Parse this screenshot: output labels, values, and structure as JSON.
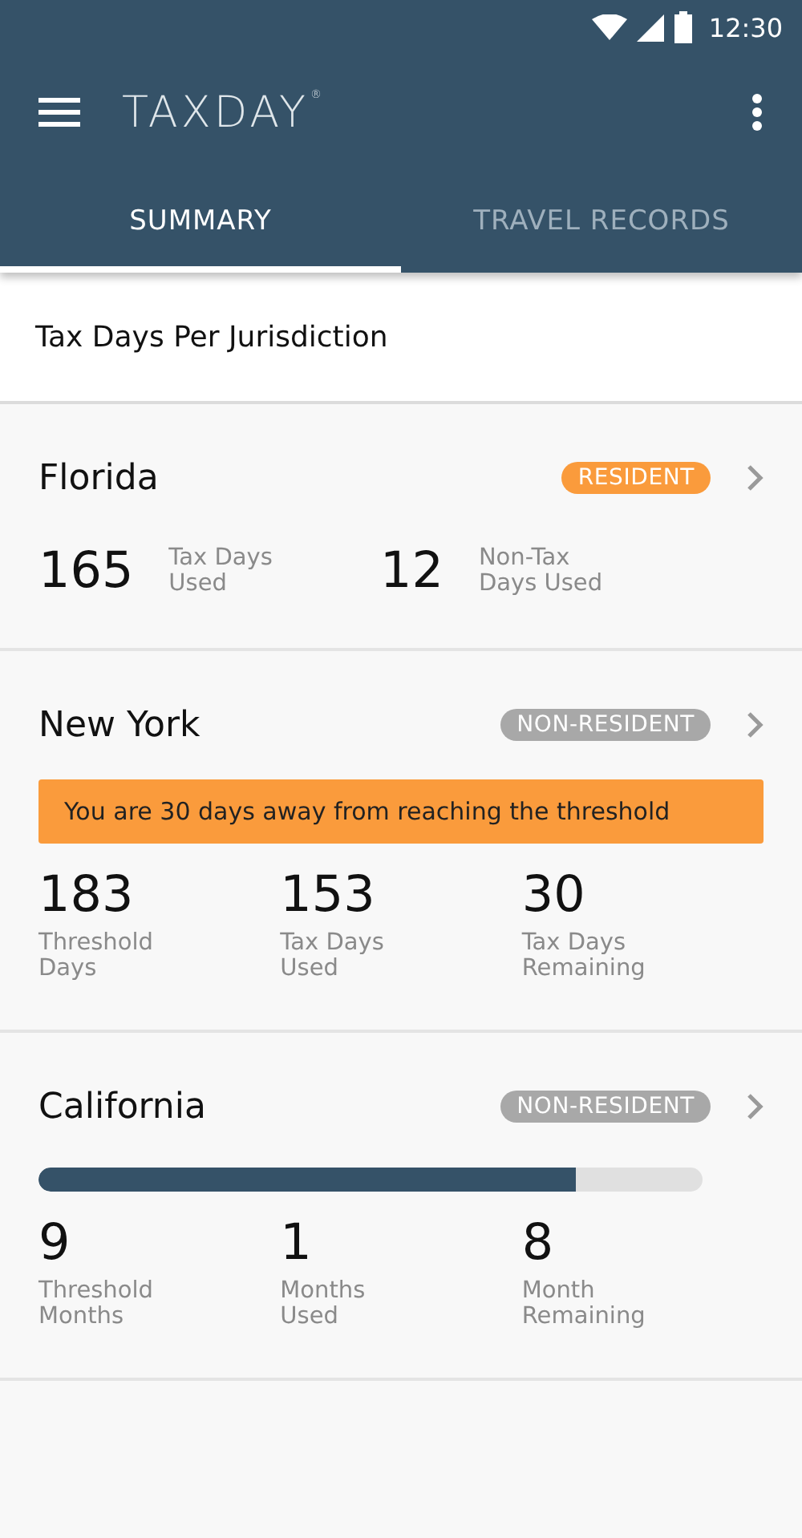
{
  "status_bar": {
    "time": "12:30"
  },
  "app_bar": {
    "title": "TAXDAY",
    "mark": "®"
  },
  "tabs": [
    {
      "label": "SUMMARY",
      "selected": true
    },
    {
      "label": "TRAVEL RECORDS",
      "selected": false
    }
  ],
  "section_title": "Tax Days Per Jurisdiction",
  "jurisdictions": [
    {
      "name": "Florida",
      "badge": {
        "text": "RESIDENT",
        "color": "#fa9b3c"
      },
      "kind": "inline",
      "stats": [
        {
          "value": "165",
          "label": "Tax Days\nUsed"
        },
        {
          "value": "12",
          "label": "Non-Tax\nDays Used"
        }
      ]
    },
    {
      "name": "New York",
      "badge": {
        "text": "NON-RESIDENT",
        "color": "#a8a8a8"
      },
      "kind": "stacked",
      "alert": "You are 30 days away from reaching the threshold",
      "stats": [
        {
          "value": "183",
          "label": "Threshold\nDays"
        },
        {
          "value": "153",
          "label": "Tax Days\nUsed"
        },
        {
          "value": "30",
          "label": "Tax Days\nRemaining"
        }
      ]
    },
    {
      "name": "California",
      "badge": {
        "text": "NON-RESIDENT",
        "color": "#a8a8a8"
      },
      "kind": "stacked",
      "progress": {
        "level": 0.81
      },
      "stats": [
        {
          "value": "9",
          "label": "Threshold\nMonths"
        },
        {
          "value": "1",
          "label": "Months\nUsed"
        },
        {
          "value": "8",
          "label": "Month\nRemaining"
        }
      ]
    }
  ]
}
